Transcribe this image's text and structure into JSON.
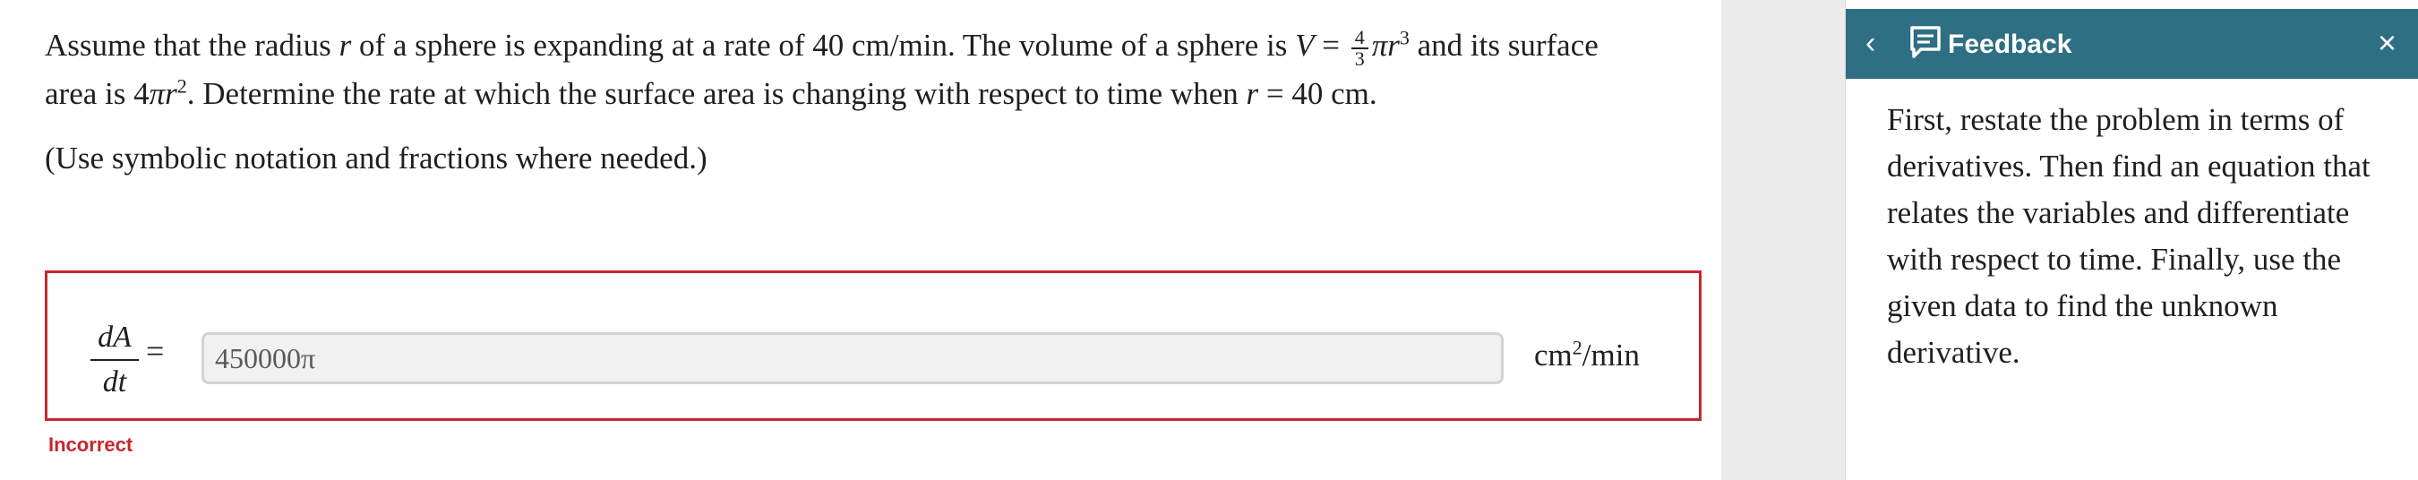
{
  "question": {
    "line1_prefix": "Assume that the radius",
    "var_r": "r",
    "line1_mid": "of a sphere is expanding at a rate of 40 cm/min. The volume of a sphere is",
    "var_V": "V",
    "equals": "=",
    "frac_num": "4",
    "frac_den": "3",
    "pi_r": "πr",
    "exp3": "3",
    "line1_suffix": "and its surface",
    "line2_prefix": "area is 4",
    "pi_r2": "πr",
    "exp2": "2",
    "line2_mid": ". Determine the rate at which the surface area is changing with respect to time when",
    "var_r2": "r",
    "line2_suffix": "= 40 cm.",
    "hint": "(Use symbolic notation and fractions where needed.)"
  },
  "answer": {
    "deriv_num": "dA",
    "deriv_den": "dt",
    "equals": "=",
    "value": "450000π",
    "units_base": "cm",
    "units_exp": "2",
    "units_suffix": "/min",
    "status": "Incorrect"
  },
  "feedback": {
    "back": "‹",
    "title": "Feedback",
    "close": "×",
    "body": "First, restate the problem in terms of derivatives. Then find an equation that relates the variables and differentiate with respect to time. Finally, use the given data to find the unknown derivative."
  },
  "colors": {
    "error": "#c8262b",
    "header": "#2f6f84"
  }
}
